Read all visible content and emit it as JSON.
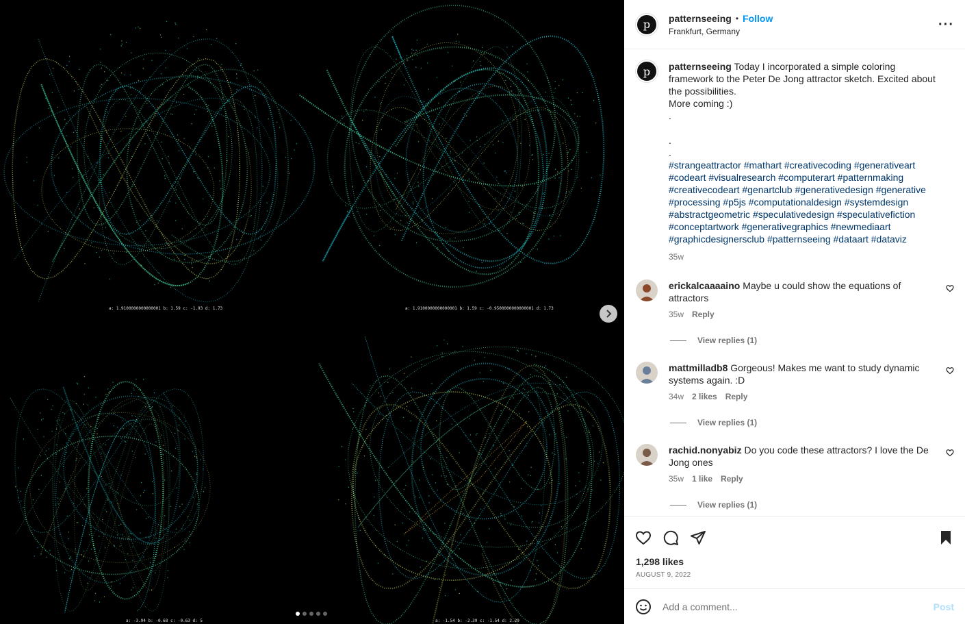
{
  "media": {
    "panels": [
      {
        "params": "a: 1.9100000000000001  b: 1.59  c: -1.93  d: 1.73"
      },
      {
        "params": "a: 1.9100000000000001  b: 1.59  c: -0.9500000000000001  d: 1.73"
      },
      {
        "params": "a: -3.94  b: -0.68  c: -0.63  d: 5"
      },
      {
        "params": "a: -1.54  b: -2.39  c: -1.54  d: 2.29"
      }
    ],
    "carousel_total": 5,
    "carousel_index": 0,
    "colors": {
      "blue": "#1ec8d8",
      "green": "#45d6a0",
      "yellow": "#c8d860",
      "orange": "#d89a30"
    }
  },
  "header": {
    "avatar_letter": "p",
    "username": "patternseeing",
    "separator": "•",
    "follow_label": "Follow",
    "location": "Frankfurt, Germany",
    "more_label": "···"
  },
  "caption": {
    "username": "patternseeing",
    "text": "Today I incorporated a simple coloring framework to the Peter De Jong attractor sketch. Excited about the possibilities.",
    "line2": "More coming :)",
    "dot1": ".",
    "dot2": ".",
    "dot3": ".",
    "hashtags": "#strangeattractor #mathart #creativecoding #generativeart #codeart #visualresearch #computerart #patternmaking #creativecodeart #genartclub #generativedesign #generative #processing #p5js #computationaldesign #systemdesign #abstractgeometric #speculativedesign #speculativefiction #conceptartwork #generativegraphics #newmediaart #graphicdesignersclub #patternseeing #dataart #dataviz",
    "age": "35w"
  },
  "comments": [
    {
      "username": "erickalcaaaaino",
      "text": "Maybe u could show the equations of attractors",
      "age": "35w",
      "likes": "",
      "reply_label": "Reply",
      "view_replies": "View replies (1)",
      "avatar_color": "#8a4a2a"
    },
    {
      "username": "mattmilladb8",
      "text": "Gorgeous! Makes me want to study dynamic systems again. :D",
      "age": "34w",
      "likes": "2 likes",
      "reply_label": "Reply",
      "view_replies": "View replies (1)",
      "avatar_color": "#6a7f9a"
    },
    {
      "username": "rachid.nonyabiz",
      "text": "Do you code these attractors? I love the De Jong ones",
      "age": "35w",
      "likes": "1 like",
      "reply_label": "Reply",
      "view_replies": "View replies (1)",
      "avatar_color": "#7a5a48"
    }
  ],
  "actions": {
    "likes": "1,298 likes",
    "date": "August 9, 2022"
  },
  "add_comment": {
    "placeholder": "Add a comment...",
    "post_label": "Post"
  }
}
